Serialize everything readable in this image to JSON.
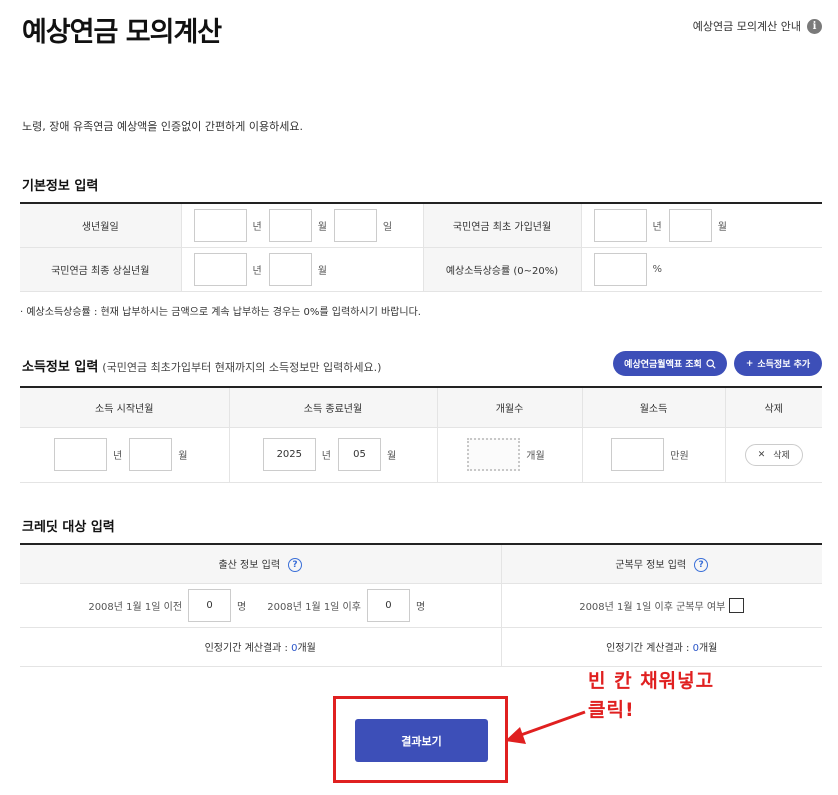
{
  "title": "예상연금 모의계산",
  "guide_link": "예상연금 모의계산 안내",
  "icons": {
    "info": "info-icon",
    "search": "search-icon",
    "plus": "plus-icon",
    "close": "close-icon",
    "question": "question-icon"
  },
  "intro": "노령, 장애 유족연금 예상액을 인증없이 간편하게 이용하세요.",
  "basic": {
    "heading": "기본정보 입력",
    "birth_label": "생년월일",
    "first_join_label": "국민연금 최초 가입년월",
    "last_loss_label": "국민연금 최종 상실년월",
    "growth_label": "예상소득상승률 (0~20%)",
    "unit_year": "년",
    "unit_month": "월",
    "unit_day": "일",
    "unit_percent": "%",
    "note": "예상소득상승률 : 현재 납부하시는 금액으로 계속 납부하는 경우는 0%를 입력하시기 바랍니다."
  },
  "income": {
    "heading": "소득정보 입력",
    "subheading": "(국민연금 최초가입부터 현재까지의 소득정보만 입력하세요.)",
    "lookup_button": "예상연금월액표 조회",
    "add_button": "소득정보 추가",
    "columns": [
      "소득 시작년월",
      "소득 종료년월",
      "개월수",
      "월소득",
      "삭제"
    ],
    "row": {
      "start_year": "",
      "start_month": "",
      "end_year": "2025",
      "end_month": "05",
      "unit_year": "년",
      "unit_month": "월",
      "months_unit": "개월",
      "income_unit": "만원",
      "delete_label": "삭제"
    }
  },
  "credit": {
    "heading": "크레딧 대상 입력",
    "birth_header": "출산 정보 입력",
    "military_header": "군복무 정보 입력",
    "before_label": "2008년 1월 1일 이전",
    "before_value": "0",
    "after_label": "2008년 1월 1일 이후",
    "after_value": "0",
    "person_unit": "명",
    "military_label": "2008년 1월 1일 이후 군복무 여부",
    "result_label": "인정기간 계산결과 : ",
    "result_value": "0",
    "result_unit": "개월",
    "military_result_label": "인정기간 계산결과 : ",
    "military_result_value": "0",
    "military_result_unit": "개월"
  },
  "result_button": "결과보기",
  "annotation": {
    "line1": "빈 칸 채워넣고",
    "line2": "클릭!"
  }
}
